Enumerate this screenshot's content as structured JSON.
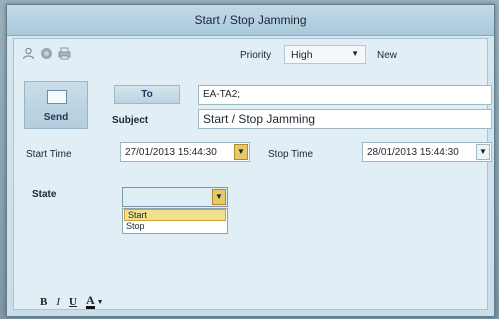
{
  "window": {
    "title": "Start / Stop Jamming"
  },
  "toolbar": {
    "icons": [
      "person-icon",
      "record-icon",
      "print-icon"
    ],
    "priority_label": "Priority",
    "priority_value": "High",
    "new_label": "New"
  },
  "compose": {
    "send_label": "Send",
    "to_label": "To",
    "to_value": "EA-TA2;",
    "subject_label": "Subject",
    "subject_value": "Start / Stop Jamming"
  },
  "timing": {
    "start_label": "Start Time",
    "start_value": "27/01/2013 15:44:30",
    "stop_label": "Stop Time",
    "stop_value": "28/01/2013 15:44:30"
  },
  "state": {
    "label": "State",
    "selected_value": "",
    "options": [
      "Start",
      "Stop"
    ],
    "highlighted_option": "Start"
  },
  "format": {
    "bold": "B",
    "italic": "I",
    "underline": "U",
    "font_color": "A"
  },
  "colors": {
    "highlight": "#f2e08a",
    "window_bg": "#e2eef5"
  }
}
